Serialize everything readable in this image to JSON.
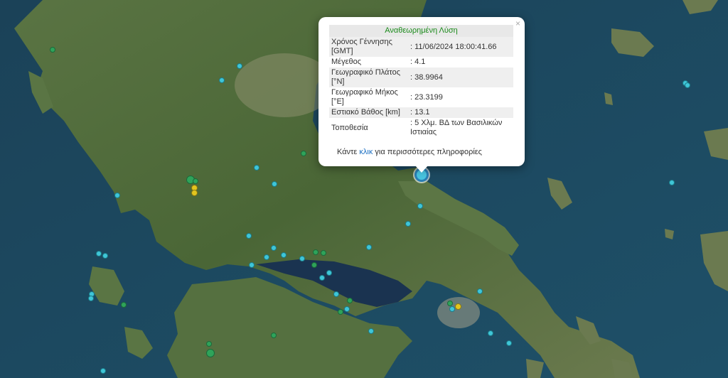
{
  "popup": {
    "header": "Αναθεωρημένη Λύση",
    "close": "×",
    "rows": [
      {
        "label": "Χρόνος Γέννησης [GMT]",
        "value": ": 11/06/2024 18:00:41.66"
      },
      {
        "label": "Μέγεθος",
        "value": ": 4.1"
      },
      {
        "label": "Γεωγραφικό Πλάτος [°N]",
        "value": ": 38.9964"
      },
      {
        "label": "Γεωγραφικό Μήκος [°E]",
        "value": ": 23.3199"
      },
      {
        "label": "Εστιακό Βάθος [km]",
        "value": ": 13.1"
      },
      {
        "label": "Τοποθεσία",
        "value": ": 5 Χλμ. ΒΔ των Βασιλικών Ιστιαίας"
      }
    ],
    "footer_before": "Κάντε ",
    "footer_link": "κλικ",
    "footer_after": " για περισσότερες πληροφορίες"
  },
  "colors": {
    "recent_event": "#3fc6d8",
    "older_event": "#2fa35a",
    "highlight_event": "#e3c51f",
    "sea": "#1f4a60",
    "land": "#4d6b3c"
  },
  "icons": {
    "close": "close-icon",
    "selected_event": "selected-event-marker"
  }
}
